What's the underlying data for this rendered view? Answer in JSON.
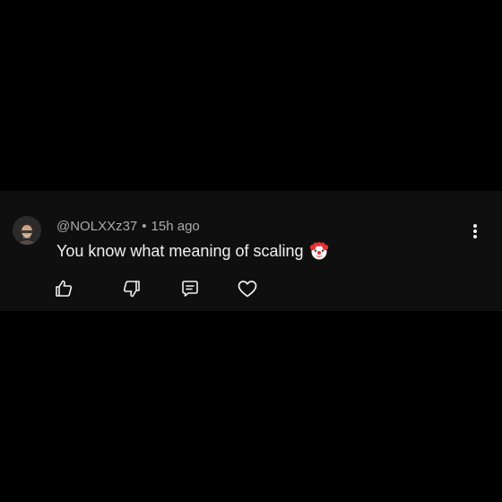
{
  "comment": {
    "author": "@NOLXXz37",
    "separator": "•",
    "timestamp": "15h ago",
    "text": "You know what meaning of scaling",
    "emoji": "clown-face"
  },
  "actions": {
    "like_icon": "thumbs-up-icon",
    "dislike_icon": "thumbs-down-icon",
    "reply_icon": "reply-comment-icon",
    "heart_icon": "heart-icon",
    "more_icon": "more-vertical-icon"
  },
  "colors": {
    "background": "#000000",
    "card": "#0f0f0f",
    "text": "#f1f1f1",
    "meta": "#aaaaaa"
  }
}
